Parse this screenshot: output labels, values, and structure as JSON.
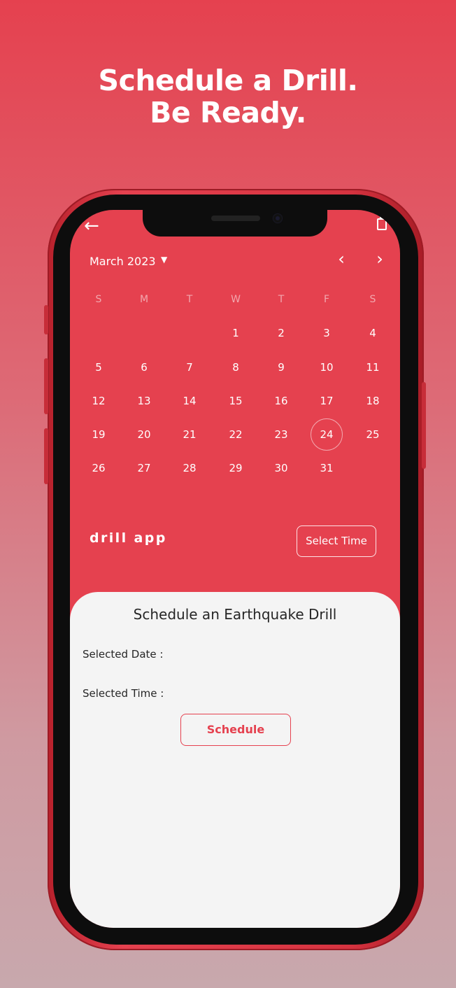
{
  "promo": {
    "headline_line1": "Schedule a Drill.",
    "headline_line2": "Be Ready."
  },
  "colors": {
    "accent": "#e5414f",
    "sheet_bg": "#f4f4f4",
    "text_dark": "#262626"
  },
  "top_bar": {
    "back_icon": "arrow-left-icon",
    "action_icon": "clipboard-icon",
    "back_glyph": "←"
  },
  "calendar": {
    "month_label": "March 2023",
    "month_caret": "▼",
    "prev_glyph": "‹",
    "next_glyph": "›",
    "weekdays": [
      "S",
      "M",
      "T",
      "W",
      "T",
      "F",
      "S"
    ],
    "selected_day": "24",
    "days": [
      "1",
      "2",
      "3",
      "4",
      "5",
      "6",
      "7",
      "8",
      "9",
      "10",
      "11",
      "12",
      "13",
      "14",
      "15",
      "16",
      "17",
      "18",
      "19",
      "20",
      "21",
      "22",
      "23",
      "24",
      "25",
      "26",
      "27",
      "28",
      "29",
      "30",
      "31"
    ]
  },
  "brand": {
    "name": "drill app"
  },
  "select_time_label": "Select Time",
  "sheet": {
    "title": "Schedule an Earthquake Drill",
    "selected_date_label": "Selected Date :",
    "selected_time_label": "Selected Time :",
    "schedule_label": "Schedule"
  }
}
